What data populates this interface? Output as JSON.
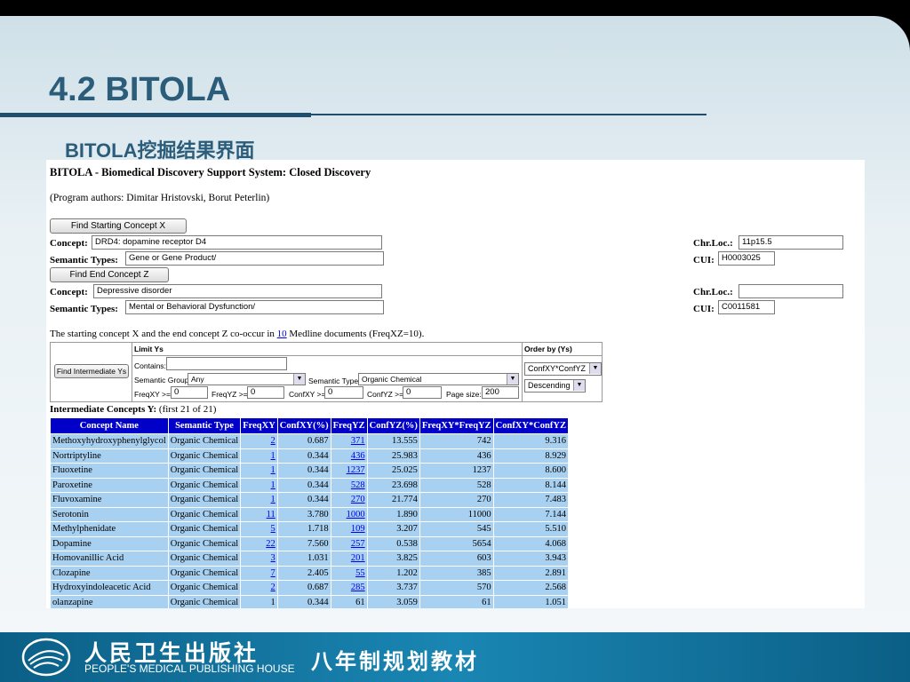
{
  "slide": {
    "title": "4.2 BITOLA",
    "subtitle": "BITOLA挖掘结果界面"
  },
  "app": {
    "heading": "BITOLA - Biomedical Discovery Support System: Closed Discovery",
    "authors": "(Program authors: Dimitar Hristovski, Borut Peterlin)",
    "find_start_label": "Find Starting Concept X",
    "find_end_label": "Find End Concept Z",
    "concept_label": "Concept:",
    "semantic_types_label": "Semantic Types:",
    "chrloc_label": "Chr.Loc.:",
    "cui_label": "CUI:",
    "start": {
      "concept": "DRD4: dopamine receptor D4",
      "semantic_types": "Gene or Gene Product/",
      "chr_loc": "11p15.5",
      "cui": "H0003025"
    },
    "end": {
      "concept": "Depressive disorder",
      "semantic_types": "Mental or Behavioral Dysfunction/",
      "chr_loc": "",
      "cui": "C0011581"
    },
    "cooccur": {
      "prefix": "The starting concept X and the end concept Z co-occur in",
      "count": "10",
      "suffix": "Medline documents (FreqXZ=10)."
    }
  },
  "limits": {
    "find_intermediate_label": "Find Intermediate Ys",
    "limit_ys_label": "Limit Ys",
    "order_by_label": "Order by (Ys)",
    "contains_label": "Contains:",
    "contains_value": "",
    "semantic_group_label": "Semantic Group:",
    "semantic_group_value": "Any",
    "semantic_type_label": "Semantic Type:",
    "semantic_type_value": "Organic Chemical",
    "freqxy_label": "FreqXY >=",
    "freqxy_value": "0",
    "freqyz_label": "FreqYZ >=",
    "freqyz_value": "0",
    "confxy_label": "ConfXY >=",
    "confxy_value": "0",
    "confyz_label": "ConfYZ >=",
    "confyz_value": "0",
    "page_size_label": "Page size:",
    "page_size_value": "200",
    "order_value": "ConfXY*ConfYZ",
    "direction_value": "Descending"
  },
  "results": {
    "title_bold": "Intermediate Concepts Y:",
    "title_rest": "(first 21 of 21)",
    "columns": [
      "Concept Name",
      "Semantic Type",
      "FreqXY",
      "ConfXY(%)",
      "FreqYZ",
      "ConfYZ(%)",
      "FreqXY*FreqYZ",
      "ConfXY*ConfYZ"
    ],
    "rows": [
      [
        "Methoxyhydroxyphenylglycol",
        "Organic Chemical",
        "2",
        "0.687",
        "371",
        "13.555",
        "742",
        "9.316"
      ],
      [
        "Nortriptyline",
        "Organic Chemical",
        "1",
        "0.344",
        "436",
        "25.983",
        "436",
        "8.929"
      ],
      [
        "Fluoxetine",
        "Organic Chemical",
        "1",
        "0.344",
        "1237",
        "25.025",
        "1237",
        "8.600"
      ],
      [
        "Paroxetine",
        "Organic Chemical",
        "1",
        "0.344",
        "528",
        "23.698",
        "528",
        "8.144"
      ],
      [
        "Fluvoxamine",
        "Organic Chemical",
        "1",
        "0.344",
        "270",
        "21.774",
        "270",
        "7.483"
      ],
      [
        "Serotonin",
        "Organic Chemical",
        "11",
        "3.780",
        "1000",
        "1.890",
        "11000",
        "7.144"
      ],
      [
        "Methylphenidate",
        "Organic Chemical",
        "5",
        "1.718",
        "109",
        "3.207",
        "545",
        "5.510"
      ],
      [
        "Dopamine",
        "Organic Chemical",
        "22",
        "7.560",
        "257",
        "0.538",
        "5654",
        "4.068"
      ],
      [
        "Homovanillic Acid",
        "Organic Chemical",
        "3",
        "1.031",
        "201",
        "3.825",
        "603",
        "3.943"
      ],
      [
        "Clozapine",
        "Organic Chemical",
        "7",
        "2.405",
        "55",
        "1.202",
        "385",
        "2.891"
      ],
      [
        "Hydroxyindoleacetic Acid",
        "Organic Chemical",
        "2",
        "0.687",
        "285",
        "3.737",
        "570",
        "2.568"
      ],
      [
        "olanzapine",
        "Organic Chemical",
        "1",
        "0.344",
        "61",
        "3.059",
        "61",
        "1.051"
      ]
    ]
  },
  "footer": {
    "publisher_cn": "人民卫生出版社",
    "publisher_en": "PEOPLE'S MEDICAL PUBLISHING HOUSE",
    "series": "八年制规划教材"
  }
}
